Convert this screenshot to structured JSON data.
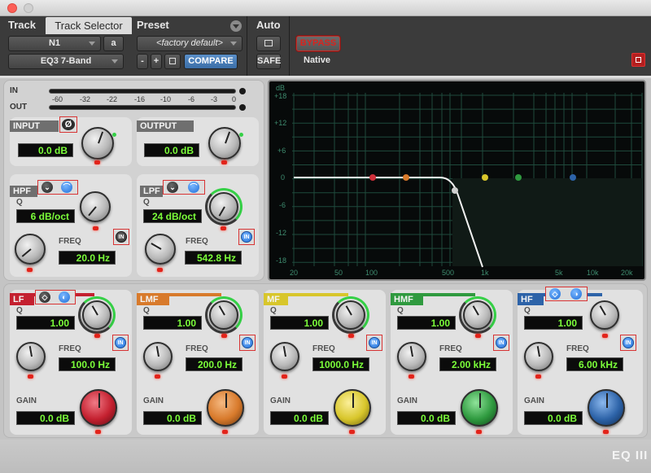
{
  "header": {
    "track_label": "Track",
    "track_selector_label": "Track Selector",
    "preset_label": "Preset",
    "auto_label": "Auto",
    "track_name": "N1",
    "track_channel": "a",
    "plugin_name": "EQ3 7-Band",
    "preset_name": "<factory default>",
    "minus_label": "-",
    "plus_label": "+",
    "compare_label": "COMPARE",
    "bypass_label": "BYPASS",
    "safe_label": "SAFE",
    "native_label": "Native"
  },
  "meters": {
    "in_label": "IN",
    "out_label": "OUT",
    "scale": [
      "-60",
      "-32",
      "-22",
      "-16",
      "-10",
      "-6",
      "-3",
      "0"
    ]
  },
  "input": {
    "title": "INPUT",
    "phase_symbol": "Ø",
    "value": "0.0 dB"
  },
  "output": {
    "title": "OUTPUT",
    "value": "0.0 dB"
  },
  "hpf": {
    "title": "HPF",
    "q_label": "Q",
    "q_value": "6 dB/oct",
    "freq_label": "FREQ",
    "freq_value": "20.0 Hz",
    "in_label": "IN"
  },
  "lpf": {
    "title": "LPF",
    "q_label": "Q",
    "q_value": "24 dB/oct",
    "freq_label": "FREQ",
    "freq_value": "542.8 Hz",
    "in_label": "IN"
  },
  "bands": [
    {
      "key": "lf",
      "title": "LF",
      "color": "#c4202f",
      "q_label": "Q",
      "q_value": "1.00",
      "freq_label": "FREQ",
      "freq_value": "100.0 Hz",
      "gain_label": "GAIN",
      "gain_value": "0.0 dB",
      "in_label": "IN"
    },
    {
      "key": "lmf",
      "title": "LMF",
      "color": "#d87a2b",
      "q_label": "Q",
      "q_value": "1.00",
      "freq_label": "FREQ",
      "freq_value": "200.0 Hz",
      "gain_label": "GAIN",
      "gain_value": "0.0 dB",
      "in_label": "IN"
    },
    {
      "key": "mf",
      "title": "MF",
      "color": "#d8c62b",
      "q_label": "Q",
      "q_value": "1.00",
      "freq_label": "FREQ",
      "freq_value": "1000.0 Hz",
      "gain_label": "GAIN",
      "gain_value": "0.0 dB",
      "in_label": "IN"
    },
    {
      "key": "hmf",
      "title": "HMF",
      "color": "#2f9a3f",
      "q_label": "Q",
      "q_value": "1.00",
      "freq_label": "FREQ",
      "freq_value": "2.00 kHz",
      "gain_label": "GAIN",
      "gain_value": "0.0 dB",
      "in_label": "IN"
    },
    {
      "key": "hf",
      "title": "HF",
      "color": "#2d63a8",
      "q_label": "Q",
      "q_value": "1.00",
      "freq_label": "FREQ",
      "freq_value": "6.00 kHz",
      "gain_label": "GAIN",
      "gain_value": "0.0 dB",
      "in_label": "IN"
    }
  ],
  "graph": {
    "db_label": "dB",
    "y_ticks": [
      "+18",
      "+12",
      "+6",
      "0",
      "-6",
      "-12",
      "-18"
    ],
    "x_ticks": [
      "20",
      "50",
      "100",
      "500",
      "1k",
      "5k",
      "10k",
      "20k"
    ]
  },
  "footer": {
    "logo": "EQ III"
  },
  "colors": {
    "lcd_text": "#7cff3a",
    "accent_blue": "#3b6ea7",
    "in_active": "#1f6ed8",
    "bypass_red": "#d8241f"
  }
}
